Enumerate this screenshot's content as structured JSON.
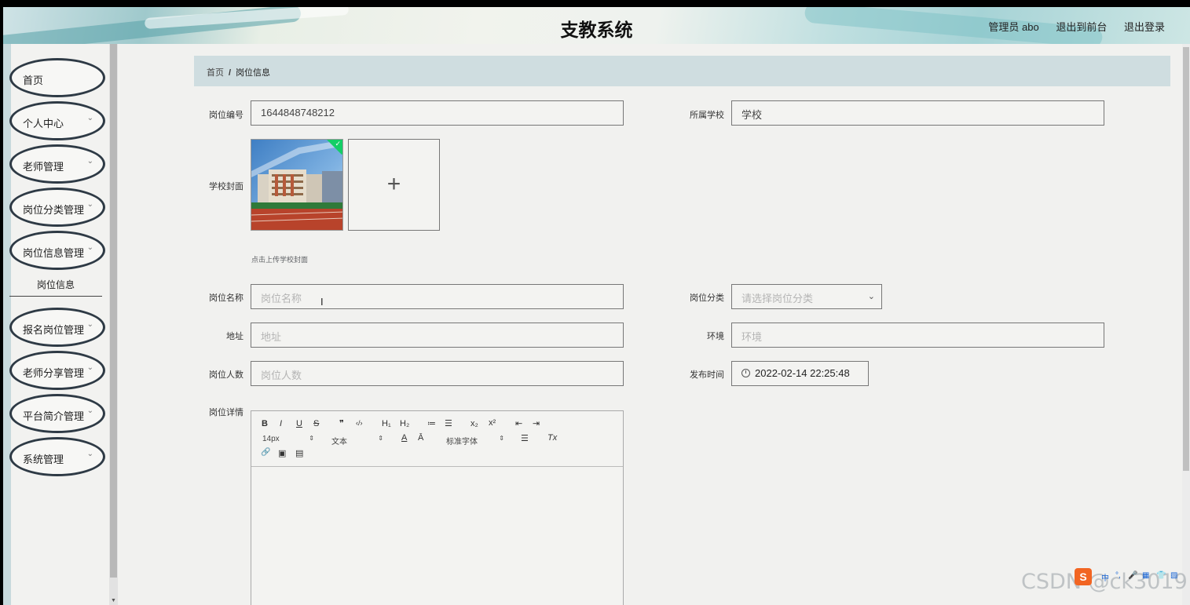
{
  "header": {
    "title": "支教系统",
    "user": "管理员 abo",
    "back_to_front": "退出到前台",
    "logout": "退出登录"
  },
  "sidebar": {
    "items": [
      {
        "label": "首页",
        "chevron": false
      },
      {
        "label": "个人中心",
        "chevron": true
      },
      {
        "label": "老师管理",
        "chevron": true
      },
      {
        "label": "岗位分类管理",
        "chevron": true
      },
      {
        "label": "岗位信息管理",
        "chevron": true
      },
      {
        "label": "报名岗位管理",
        "chevron": true
      },
      {
        "label": "老师分享管理",
        "chevron": true
      },
      {
        "label": "平台简介管理",
        "chevron": true
      },
      {
        "label": "系统管理",
        "chevron": true
      }
    ],
    "chevron_glyph": "⌄",
    "active_sub": "岗位信息"
  },
  "breadcrumb": {
    "home": "首页",
    "sep": "/",
    "current": "岗位信息"
  },
  "form": {
    "job_no": {
      "label": "岗位编号",
      "value": "1644848748212"
    },
    "school": {
      "label": "所属学校",
      "value": "学校"
    },
    "cover": {
      "label": "学校封面",
      "tip": "点击上传学校封面",
      "plus": "+",
      "check": "✓"
    },
    "job_name": {
      "label": "岗位名称",
      "placeholder": "岗位名称"
    },
    "job_category": {
      "label": "岗位分类",
      "placeholder": "请选择岗位分类",
      "caret": "⌄"
    },
    "address": {
      "label": "地址",
      "placeholder": "地址"
    },
    "environment": {
      "label": "环境",
      "placeholder": "环境"
    },
    "headcount": {
      "label": "岗位人数",
      "placeholder": "岗位人数"
    },
    "publish_time": {
      "label": "发布时间",
      "value": "2022-02-14 22:25:48"
    },
    "detail": {
      "label": "岗位详情"
    }
  },
  "editor": {
    "bold": "B",
    "italic": "I",
    "underline": "U",
    "strike": "S",
    "quote": "❞",
    "code": "‹/›",
    "h1": "H₁",
    "h2": "H₂",
    "ol": "≔",
    "ul": "☰",
    "sub": "x₂",
    "sup": "x²",
    "outdent": "⇤",
    "indent": "⇥",
    "size": "14px",
    "format": "文本",
    "font": "标准字体",
    "color": "A",
    "bg": "Ā",
    "align": "☰",
    "clean": "Tx",
    "link": "🔗",
    "image": "▣",
    "video": "▤",
    "updown": "⇕"
  },
  "watermark": "CSDN @ck3019",
  "ime": {
    "logo": "S",
    "items": [
      "中",
      "°,",
      "🎤",
      "▦",
      "👕",
      "▧"
    ]
  }
}
